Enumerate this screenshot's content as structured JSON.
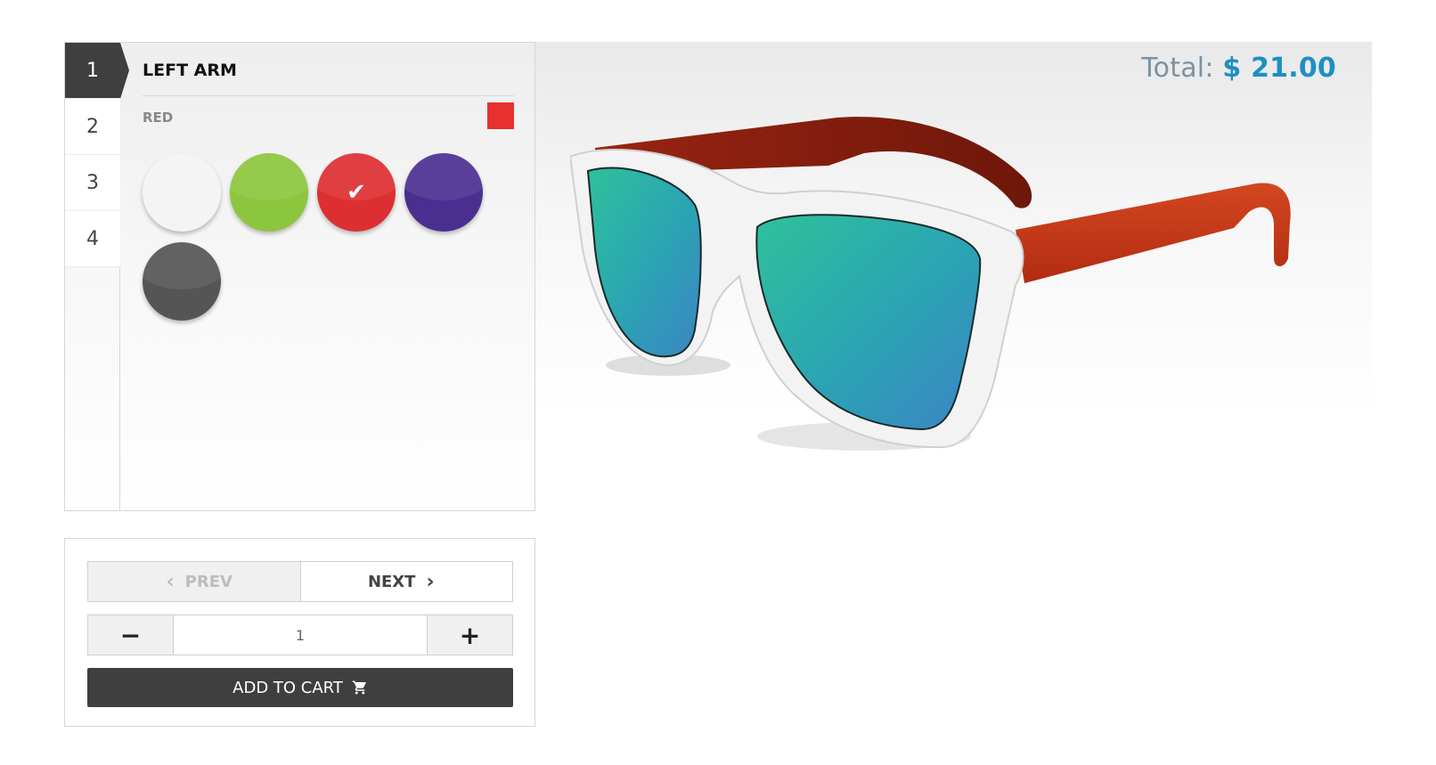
{
  "total": {
    "label": "Total:",
    "amount": "$ 21.00"
  },
  "steps": [
    "1",
    "2",
    "3",
    "4"
  ],
  "active_step": "1",
  "section": {
    "title": "LEFT ARM"
  },
  "selected": {
    "label": "RED",
    "color": "#e83030"
  },
  "swatches": [
    {
      "name": "white",
      "color": "#f4f4f4",
      "selected": false
    },
    {
      "name": "green",
      "color": "#8cc63e",
      "selected": false
    },
    {
      "name": "red",
      "color": "#dd2f31",
      "selected": true
    },
    {
      "name": "purple",
      "color": "#4a2f91",
      "selected": false
    },
    {
      "name": "gray",
      "color": "#555555",
      "selected": false
    }
  ],
  "nav": {
    "prev_label": "PREV",
    "next_label": "NEXT"
  },
  "quantity": {
    "value": "1",
    "minus": "−",
    "plus": "+"
  },
  "cart": {
    "label": "ADD TO CART"
  },
  "icons": {
    "prev": "chevron-left-icon",
    "next": "chevron-right-icon",
    "cart": "shopping-cart-icon",
    "check": "check-icon"
  }
}
